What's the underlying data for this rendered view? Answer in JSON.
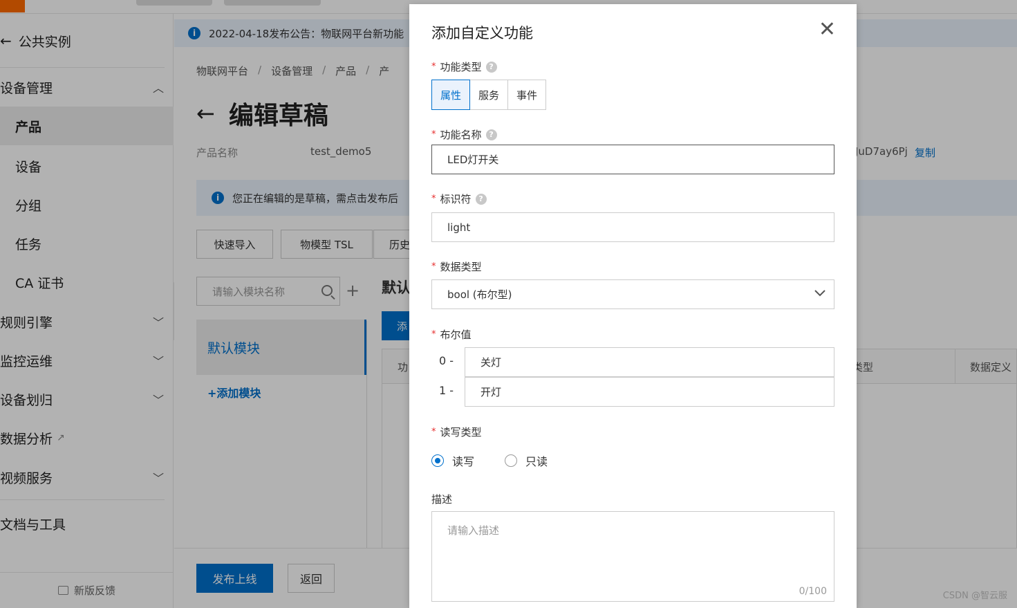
{
  "sidebar": {
    "back_label": "公共实例",
    "items": [
      {
        "label": "设备管理",
        "expanded": true
      },
      {
        "label": "产品",
        "active": true
      },
      {
        "label": "设备"
      },
      {
        "label": "分组"
      },
      {
        "label": "任务"
      },
      {
        "label": "CA 证书"
      },
      {
        "label": "规则引擎"
      },
      {
        "label": "监控运维"
      },
      {
        "label": "设备划归"
      },
      {
        "label": "数据分析"
      },
      {
        "label": "视频服务"
      },
      {
        "label": "文档与工具"
      }
    ],
    "feedback": "新版反馈"
  },
  "notice": {
    "text": "2022-04-18发布公告：物联网平台新功能"
  },
  "breadcrumb": [
    "物联网平台",
    "设备管理",
    "产品",
    "产"
  ],
  "page": {
    "title": "编辑草稿",
    "product_name_label": "产品名称",
    "product_name_value": "test_demo5",
    "product_key_partial": "JuD7ay6Pj",
    "copy_label": "复制",
    "edit_notice": "您正在编辑的是草稿，需点击发布后",
    "buttons": {
      "quick_import": "快速导入",
      "tsl": "物模型 TSL",
      "history": "历史"
    },
    "search_placeholder": "请输入模块名称",
    "module_name": "默认模块",
    "add_module": "+添加模块",
    "section_title": "默认",
    "add_button": "添",
    "table_headers": [
      "功",
      "类型",
      "数据定义"
    ],
    "publish": "发布上线",
    "back": "返回"
  },
  "dialog": {
    "title": "添加自定义功能",
    "function_type_label": "功能类型",
    "function_types": [
      {
        "label": "属性",
        "active": true
      },
      {
        "label": "服务",
        "active": false
      },
      {
        "label": "事件",
        "active": false
      }
    ],
    "function_name_label": "功能名称",
    "function_name_value": "LED灯开关",
    "identifier_label": "标识符",
    "identifier_value": "light",
    "data_type_label": "数据类型",
    "data_type_value": "bool (布尔型)",
    "bool_label": "布尔值",
    "bool_values": [
      {
        "key": "0 -",
        "value": "关灯"
      },
      {
        "key": "1 -",
        "value": "开灯"
      }
    ],
    "rw_label": "读写类型",
    "rw_options": [
      {
        "label": "读写",
        "checked": true
      },
      {
        "label": "只读",
        "checked": false
      }
    ],
    "desc_label": "描述",
    "desc_placeholder": "请输入描述",
    "desc_counter": "0/100",
    "required_mark": "*"
  },
  "watermark": "CSDN @智云服",
  "colors": {
    "primary": "#0070cc",
    "brand": "#ff6a00",
    "required": "#e62e2e"
  }
}
